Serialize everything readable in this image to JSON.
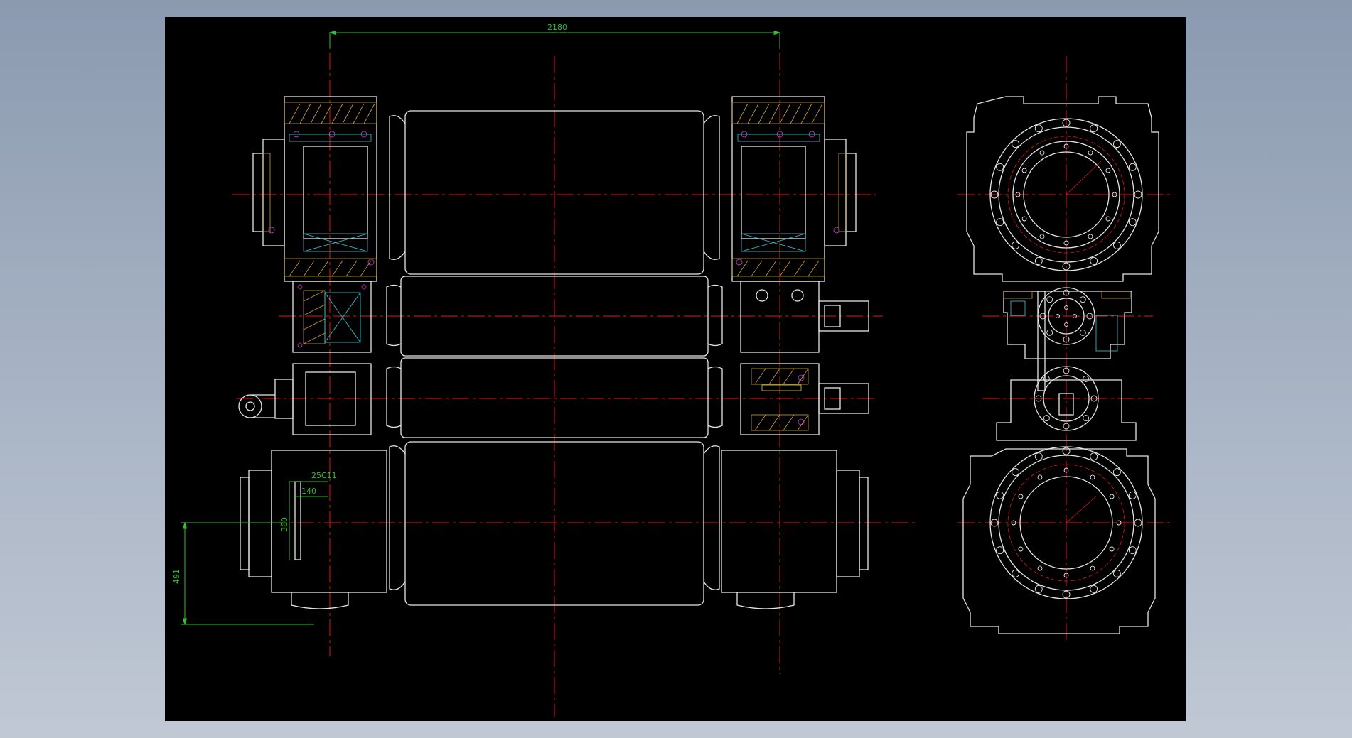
{
  "colors": {
    "background": "#000000",
    "outline": "#e6e6e6",
    "centerline": "#e01818",
    "dimension": "#2ec22e",
    "hatch": "#c8a040",
    "accent_cyan": "#3cc8d8",
    "accent_magenta": "#d040d0",
    "accent_yellow": "#e0d030"
  },
  "dimensions": {
    "overall_width": "2180",
    "slot_width": "25C11",
    "slot_offset": "140",
    "slot_height": "360",
    "side_height": "491"
  },
  "views": {
    "front": "roll-assembly-front-view",
    "side": "roll-assembly-side-view"
  }
}
